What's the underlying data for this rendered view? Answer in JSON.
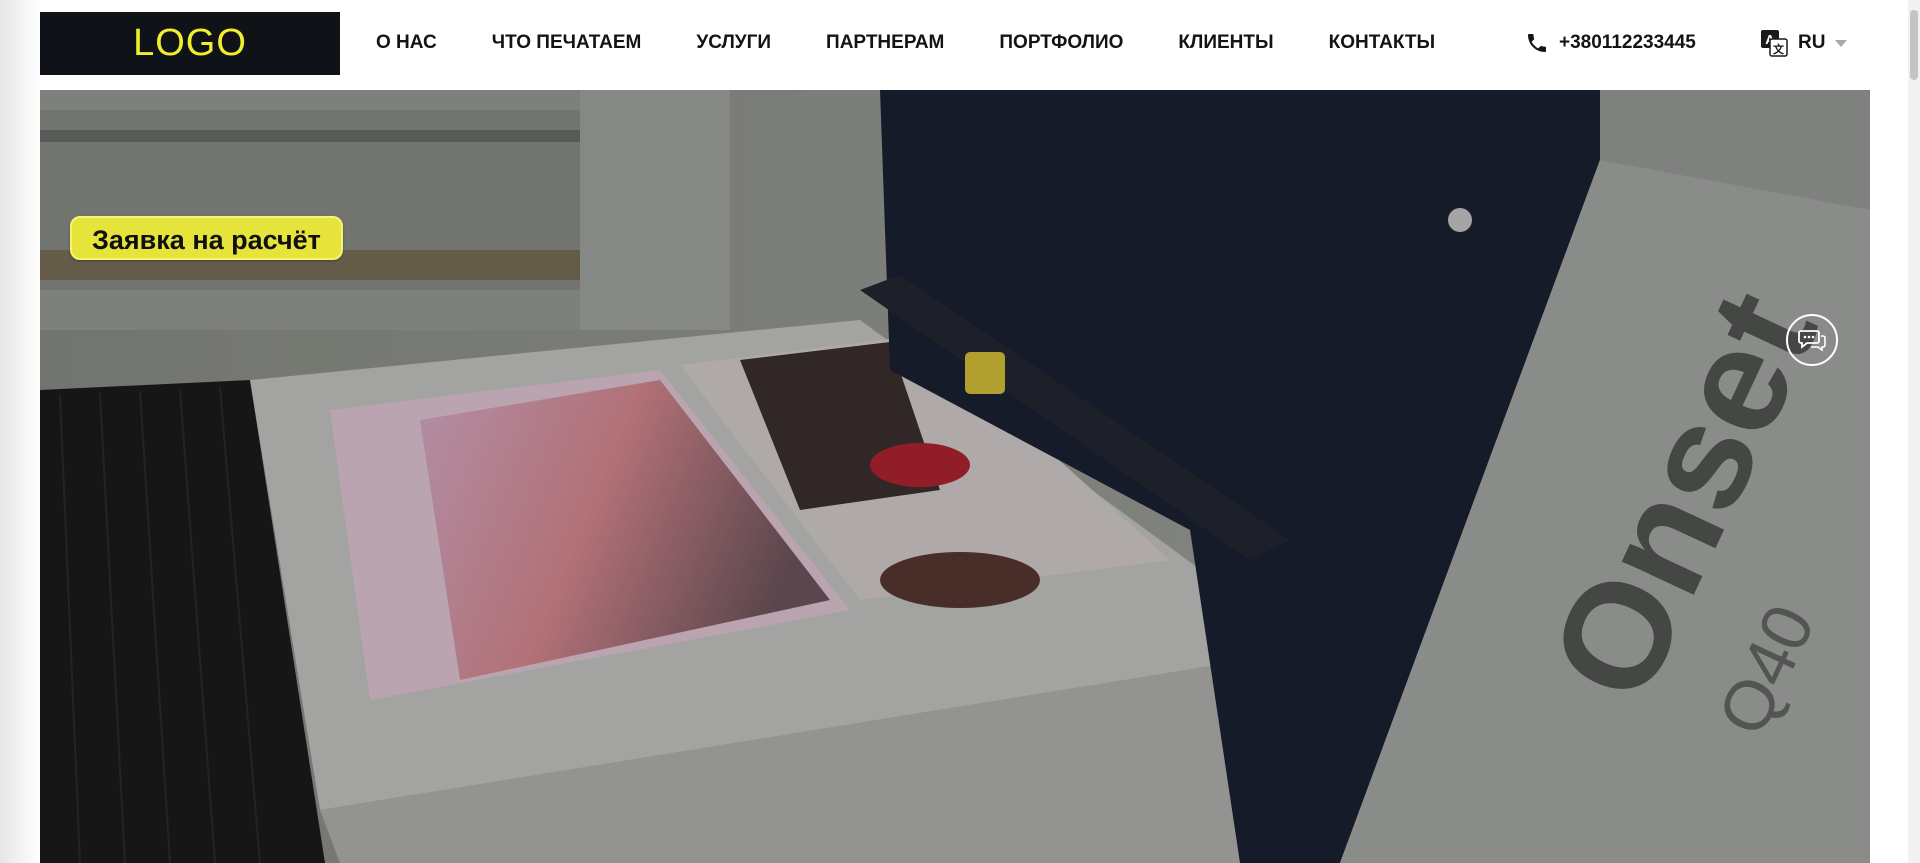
{
  "header": {
    "logo": "LOGO",
    "nav": [
      {
        "label": "О НАС"
      },
      {
        "label": "ЧТО ПЕЧАТАЕМ"
      },
      {
        "label": "УСЛУГИ"
      },
      {
        "label": "ПАРТНЕРАМ"
      },
      {
        "label": "ПОРТФОЛИО"
      },
      {
        "label": "КЛИЕНТЫ"
      },
      {
        "label": "КОНТАКТЫ"
      }
    ],
    "phone": "+380112233445",
    "phone_icon": "phone-icon",
    "language": "RU",
    "language_icon": "translate-icon"
  },
  "hero": {
    "request_button": "Заявка на расчёт",
    "chat_icon": "chat-bubbles-icon",
    "printer_brand": "Onset",
    "printer_model": "Q40"
  },
  "colors": {
    "logo_bg": "#0f1317",
    "logo_text": "#f2ee2e",
    "accent_button": "#e6e33a",
    "nav_text": "#141414"
  }
}
